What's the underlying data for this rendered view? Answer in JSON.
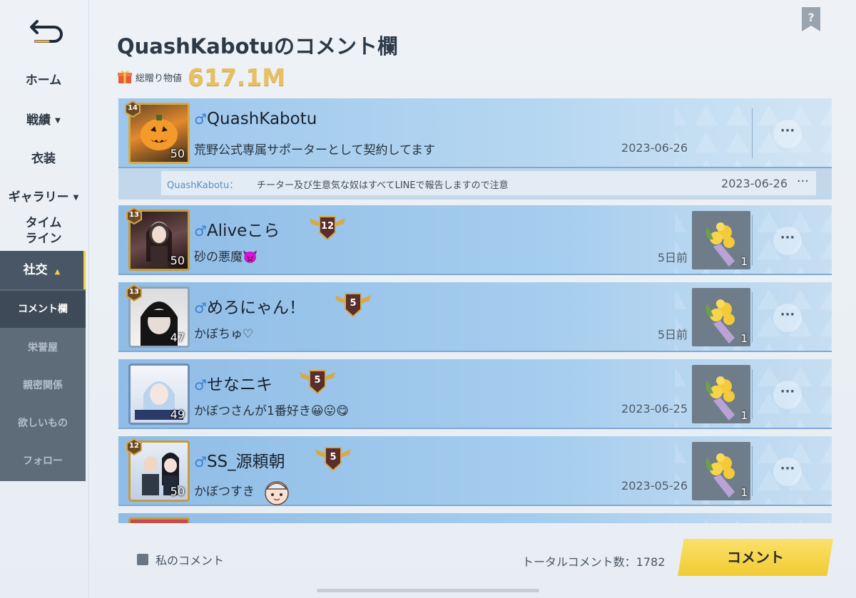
{
  "sidebar": {
    "items": [
      {
        "label": "ホーム"
      },
      {
        "label": "戦績"
      },
      {
        "label": "衣装"
      },
      {
        "label": "ギャラリー"
      },
      {
        "label": "タイム"
      },
      {
        "label": "ライン"
      }
    ],
    "social": {
      "label": "社交",
      "subitems": [
        {
          "label": "コメント欄"
        },
        {
          "label": "栄誉屋"
        },
        {
          "label": "親密関係"
        },
        {
          "label": "欲しいもの"
        },
        {
          "label": "フォロー"
        }
      ]
    }
  },
  "header": {
    "title": "QuashKabotuのコメント欄",
    "gift_label": "総贈り物値",
    "gift_value": "617.1M"
  },
  "comments": [
    {
      "username": "QuashKabotu",
      "gender_symbol": "♂",
      "message": "荒野公式専属サポーターとして契約してます",
      "date": "2023-06-26",
      "avatar_level": "50",
      "rank": "14",
      "more": "···",
      "reply": {
        "name": "QuashKabotu：",
        "text": "チーター及び生意気な奴はすべてLINEで報告しますので注意",
        "date": "2023-06-26",
        "more": "···"
      }
    },
    {
      "username": "Aliveこら",
      "gender_symbol": "♂",
      "message": "砂の悪魔",
      "emoji": "👿",
      "date": "5日前",
      "avatar_level": "50",
      "rank": "13",
      "badge_level": "12",
      "gift_count": "1",
      "more": "···"
    },
    {
      "username": "めろにゃん！",
      "gender_symbol": "♂",
      "message": "かぼちゅ♡",
      "date": "5日前",
      "avatar_level": "47",
      "rank": "13",
      "badge_level": "5",
      "gift_count": "1",
      "more": "···"
    },
    {
      "username": "せなニキ",
      "gender_symbol": "♂",
      "message": "かぼつさんが1番好き",
      "emoji": "😀😛😋",
      "date": "2023-06-25",
      "avatar_level": "49",
      "rank": "",
      "badge_level": "5",
      "gift_count": "1",
      "more": "···"
    },
    {
      "username": "SS_源頼朝",
      "gender_symbol": "♂",
      "message": "かぼつすき",
      "date": "2023-05-26",
      "avatar_level": "50",
      "rank": "12",
      "badge_level": "5",
      "gift_count": "1",
      "more": "···"
    }
  ],
  "footer": {
    "my_comment_label": "私のコメント",
    "total_label": "トータルコメント数：1782",
    "comment_button": "コメント"
  },
  "colors": {
    "card_blue": "#a5cdee",
    "accent_yellow": "#f1cb32",
    "gift_gold": "#e8c063",
    "sidebar_dark": "#485665"
  }
}
